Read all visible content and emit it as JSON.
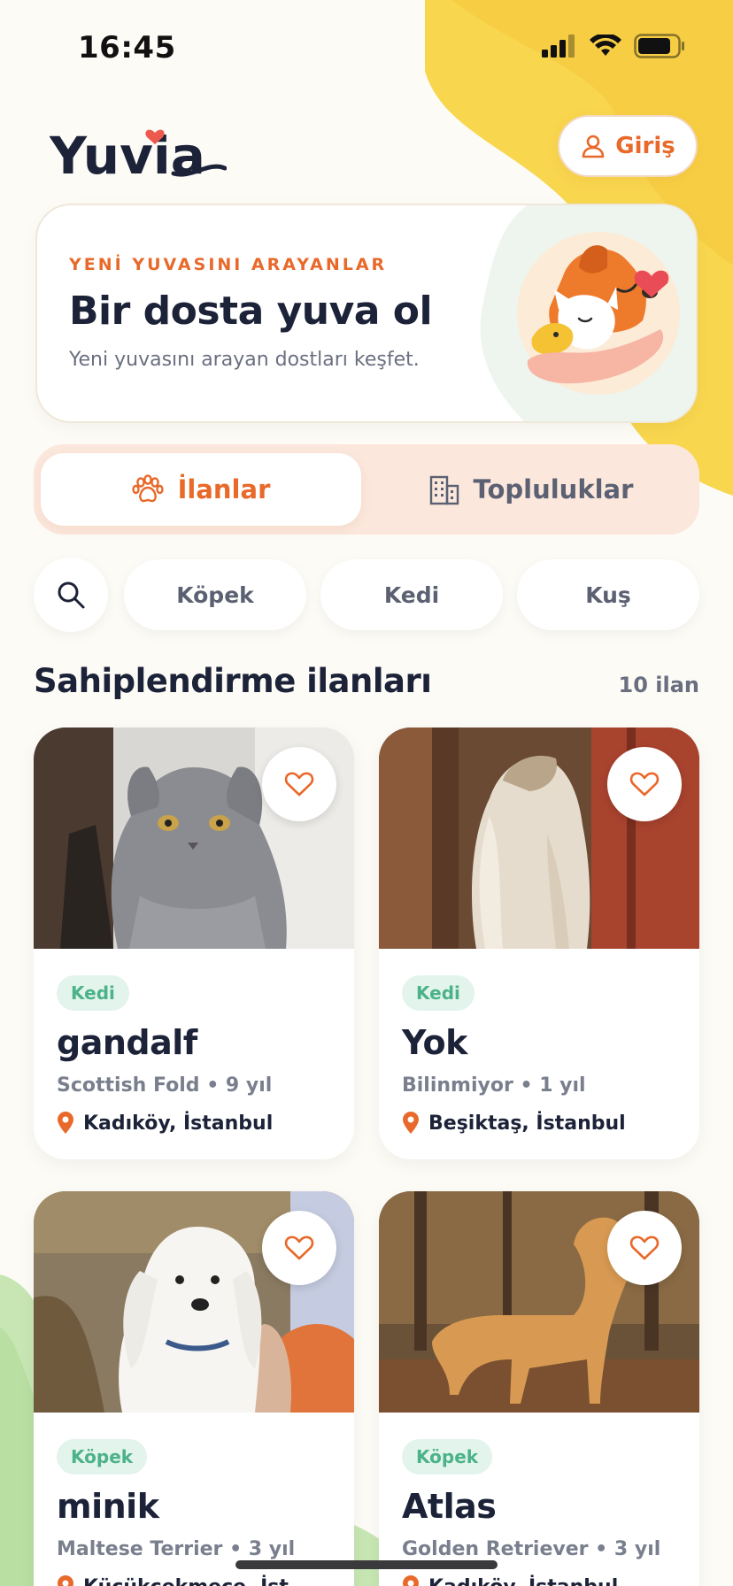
{
  "status_bar": {
    "time": "16:45"
  },
  "header": {
    "logo_text": "Yuvia",
    "login_label": "Giriş"
  },
  "hero": {
    "eyebrow": "YENİ YUVASINI ARAYANLAR",
    "title": "Bir dosta yuva ol",
    "subtitle": "Yeni yuvasını arayan dostları keşfet."
  },
  "tabs": [
    {
      "label": "İlanlar",
      "icon": "paw-icon",
      "active": true
    },
    {
      "label": "Topluluklar",
      "icon": "building-icon",
      "active": false
    }
  ],
  "filters": {
    "search_icon": "search-icon",
    "chips": [
      "Köpek",
      "Kedi",
      "Kuş"
    ]
  },
  "section": {
    "title": "Sahiplendirme ilanları",
    "count": "10 ilan"
  },
  "listings": [
    {
      "tag": "Kedi",
      "name": "gandalf",
      "meta": "Scottish Fold • 9 yıl",
      "location": "Kadıköy, İstanbul"
    },
    {
      "tag": "Kedi",
      "name": "Yok",
      "meta": "Bilinmiyor • 1 yıl",
      "location": "Beşiktaş, İstanbul"
    },
    {
      "tag": "Köpek",
      "name": "minik",
      "meta": "Maltese Terrier • 3 yıl",
      "location": "Küçükçekmece, İst..."
    },
    {
      "tag": "Köpek",
      "name": "Atlas",
      "meta": "Golden Retriever • 3 yıl",
      "location": "Kadıköy, İstanbul"
    }
  ],
  "colors": {
    "accent": "#e8692a",
    "tag_bg": "#e3f4ec",
    "tag_text": "#4bb289",
    "yellow": "#f6d24a",
    "green": "#b9e0a5"
  }
}
